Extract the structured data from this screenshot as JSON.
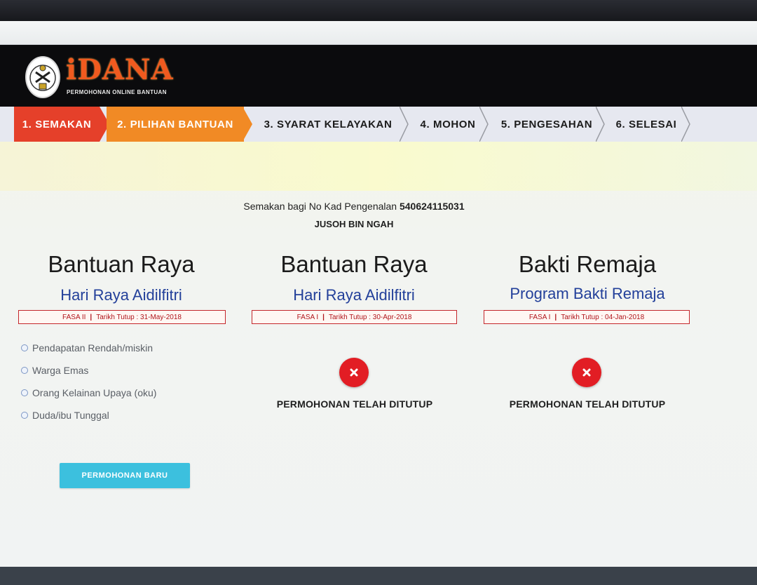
{
  "header": {
    "logo_text": "iDANA",
    "logo_subtitle": "PERMOHONAN ONLINE BANTUAN"
  },
  "steps": [
    {
      "label": "1. SEMAKAN",
      "state": "done"
    },
    {
      "label": "2. PILIHAN BANTUAN",
      "state": "current"
    },
    {
      "label": "3. SYARAT KELAYAKAN",
      "state": "pending"
    },
    {
      "label": "4. MOHON",
      "state": "pending"
    },
    {
      "label": "5. PENGESAHAN",
      "state": "pending"
    },
    {
      "label": "6. SELESAI",
      "state": "pending"
    }
  ],
  "check": {
    "prefix": "Semakan bagi No Kad Pengenalan",
    "ic_number": "540624115031",
    "name": "JUSOH BIN NGAH"
  },
  "programs": [
    {
      "title": "Bantuan Raya",
      "subtitle": "Hari Raya Aidilfitri",
      "phase": "FASA II",
      "closing": "Tarikh Tutup : 31-May-2018",
      "options": [
        "Pendapatan Rendah/miskin",
        "Warga Emas",
        "Orang Kelainan Upaya (oku)",
        "Duda/ibu Tunggal"
      ],
      "button_label": "PERMOHONAN BARU"
    },
    {
      "title": "Bantuan Raya",
      "subtitle": "Hari Raya Aidilfitri",
      "phase": "FASA I",
      "closing": "Tarikh Tutup : 30-Apr-2018",
      "status_text": "PERMOHONAN TELAH DITUTUP"
    },
    {
      "title": "Bakti Remaja",
      "subtitle": "Program Bakti Remaja",
      "phase": "FASA I",
      "closing": "Tarikh Tutup : 04-Jan-2018",
      "status_text": "PERMOHONAN TELAH DITUTUP"
    }
  ],
  "colors": {
    "step_done": "#e5402a",
    "step_current": "#f18a25",
    "accent_blue": "#23409a",
    "button": "#3cc0de",
    "closed": "#e21d24"
  },
  "icons": {
    "closed": "close-icon",
    "radio": "radio-unchecked-icon"
  }
}
